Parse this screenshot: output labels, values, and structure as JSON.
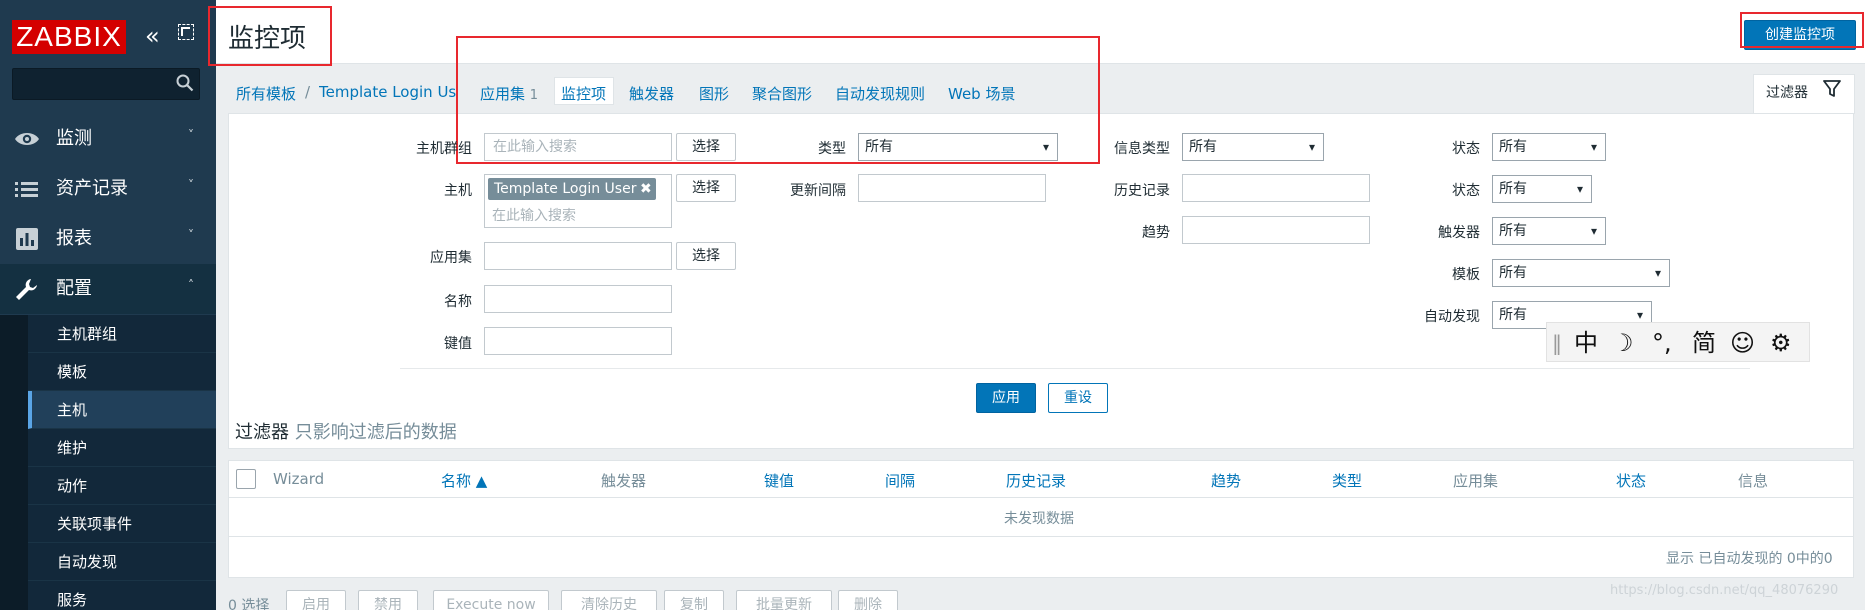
{
  "app": {
    "logo": "ZABBIX",
    "collapse": "«"
  },
  "sidebar": {
    "menu": [
      {
        "label": "监测",
        "icon": "eye-icon",
        "chevron": "˅"
      },
      {
        "label": "资产记录",
        "icon": "list-icon",
        "chevron": "˅"
      },
      {
        "label": "报表",
        "icon": "bar-chart-icon",
        "chevron": "˅"
      },
      {
        "label": "配置",
        "icon": "wrench-icon",
        "chevron": "˄"
      }
    ],
    "submenu": [
      "主机群组",
      "模板",
      "主机",
      "维护",
      "动作",
      "关联项事件",
      "自动发现",
      "服务"
    ]
  },
  "header": {
    "title": "监控项",
    "create_button": "创建监控项"
  },
  "breadcrumb": {
    "all_templates": "所有模板",
    "separator": "/",
    "template": "Template Login User"
  },
  "tabs": [
    {
      "label": "应用集",
      "count": "1"
    },
    {
      "label": "监控项"
    },
    {
      "label": "触发器"
    },
    {
      "label": "图形"
    },
    {
      "label": "聚合图形"
    },
    {
      "label": "自动发现规则"
    },
    {
      "label": "Web 场景"
    }
  ],
  "filter": {
    "tab_label": "过滤器",
    "host_groups": {
      "label": "主机群组",
      "placeholder": "在此输入搜索",
      "button": "选择"
    },
    "hosts": {
      "label": "主机",
      "chip": "Template Login User",
      "chip_remove": "✖",
      "placeholder": "在此输入搜索",
      "button": "选择"
    },
    "applications": {
      "label": "应用集",
      "button": "选择"
    },
    "name": {
      "label": "名称",
      "value": ""
    },
    "key": {
      "label": "键值",
      "value": ""
    },
    "type": {
      "label": "类型",
      "value": "所有"
    },
    "update_interval": {
      "label": "更新间隔",
      "value": ""
    },
    "info_type": {
      "label": "信息类型",
      "value": "所有"
    },
    "history": {
      "label": "历史记录",
      "value": ""
    },
    "trends": {
      "label": "趋势",
      "value": ""
    },
    "state": {
      "label": "状态",
      "value": "所有"
    },
    "status": {
      "label": "状态",
      "value": "所有"
    },
    "triggers": {
      "label": "触发器",
      "value": "所有"
    },
    "template": {
      "label": "模板",
      "value": "所有"
    },
    "discovery": {
      "label": "自动发现",
      "value": "所有"
    },
    "apply": "应用",
    "reset": "重设",
    "caption": "过滤器",
    "caption_sub": "只影响过滤后的数据"
  },
  "ime": {
    "items": [
      "中",
      "☽",
      "°,",
      "简",
      "☺",
      "⚙"
    ],
    "grip": "‖"
  },
  "table": {
    "columns": [
      "Wizard",
      "名称 ▲",
      "触发器",
      "键值",
      "间隔",
      "历史记录",
      "趋势",
      "类型",
      "应用集",
      "状态",
      "信息"
    ],
    "empty": "未发现数据",
    "paging": "显示 已自动发现的 0中的0"
  },
  "actions": {
    "selected": "0 选择",
    "buttons": [
      "启用",
      "禁用",
      "Execute now",
      "清除历史",
      "复制",
      "批量更新",
      "删除"
    ]
  },
  "watermark": "https://blog.csdn.net/qq_48076290"
}
